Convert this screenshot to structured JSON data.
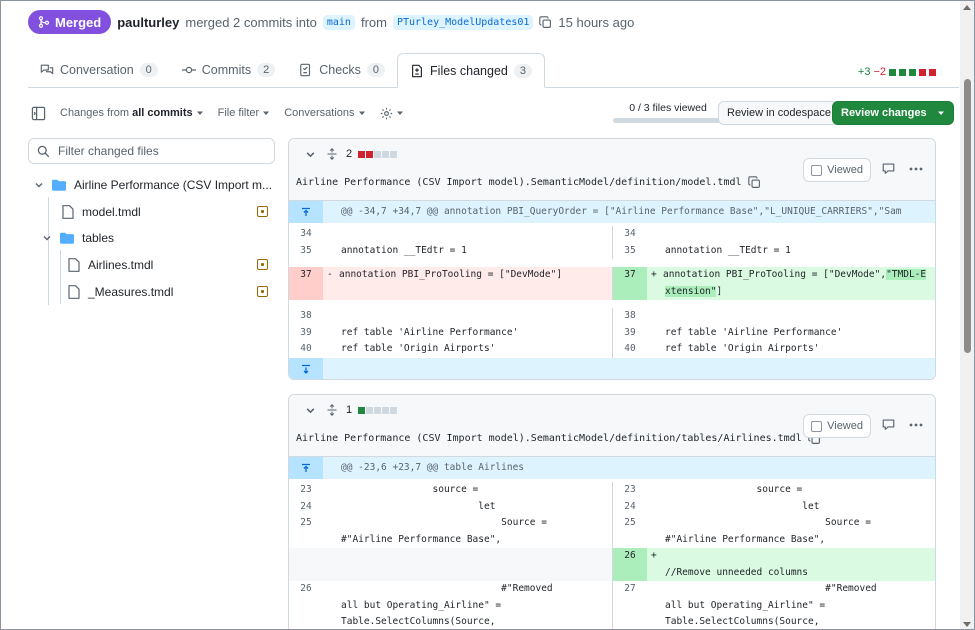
{
  "header": {
    "status": "Merged",
    "user": "paulturley",
    "action": "merged 2 commits into",
    "base_branch": "main",
    "from": "from",
    "head_branch": "PTurley_ModelUpdates01",
    "time": "15 hours ago"
  },
  "tabs": [
    {
      "label": "Conversation",
      "count": "0"
    },
    {
      "label": "Commits",
      "count": "2"
    },
    {
      "label": "Checks",
      "count": "0"
    },
    {
      "label": "Files changed",
      "count": "3"
    }
  ],
  "diffstat": {
    "additions": "+3",
    "deletions": "−2"
  },
  "toolbar": {
    "changes_from_prefix": "Changes from",
    "changes_from_value": "all commits",
    "file_filter": "File filter",
    "conversations": "Conversations",
    "files_viewed": "0 / 3 files viewed",
    "review_codespace": "Review in codespace",
    "review_changes": "Review changes"
  },
  "sidebar": {
    "search_placeholder": "Filter changed files",
    "tree": {
      "root_folder": "Airline Performance (CSV Import m...",
      "file_model": "model.tmdl",
      "folder_tables": "tables",
      "file_airlines": "Airlines.tmdl",
      "file_measures": "_Measures.tmdl"
    }
  },
  "diff1": {
    "changes": "2",
    "path": "Airline Performance (CSV Import model).SemanticModel/definition/model.tmdl",
    "viewed_label": "Viewed",
    "hunk": "@@ -34,7 +34,7 @@ annotation PBI_QueryOrder = [\"Airline Performance Base\",\"L_UNIQUE_CARRIERS\",\"Sam",
    "rows": [
      {
        "l_num": "34",
        "l_code": "",
        "r_num": "34",
        "r_code": ""
      },
      {
        "l_num": "35",
        "l_code": "annotation __TEdtr = 1",
        "r_num": "35",
        "r_code": "annotation __TEdtr = 1"
      },
      {
        "l_num": "37",
        "l_code": "annotation PBI_ProTooling = [\"DevMode\"]",
        "r_num": "37",
        "r_code_a": "annotation PBI_ProTooling = [\"DevMode\",",
        "r_code_b": "\"TMDL-Extension\"",
        "r_code_c": "]"
      },
      {
        "l_num": "38",
        "l_code": "",
        "r_num": "38",
        "r_code": ""
      },
      {
        "l_num": "39",
        "l_code": "ref table 'Airline Performance'",
        "r_num": "39",
        "r_code": "ref table 'Airline Performance'"
      },
      {
        "l_num": "40",
        "l_code": "ref table 'Origin Airports'",
        "r_num": "40",
        "r_code": "ref table 'Origin Airports'"
      }
    ]
  },
  "diff2": {
    "changes": "1",
    "path": "Airline Performance (CSV Import model).SemanticModel/definition/tables/Airlines.tmdl",
    "viewed_label": "Viewed",
    "hunk": "@@ -23,6 +23,7 @@ table Airlines",
    "rows": [
      {
        "l_num": "23",
        "l_code": "                source =",
        "r_num": "23",
        "r_code": "                source ="
      },
      {
        "l_num": "24",
        "l_code": "                        let",
        "r_num": "24",
        "r_code": "                        let"
      },
      {
        "l_num": "25",
        "l_code": "                            Source =\n#\"Airline Performance Base\",",
        "r_num": "25",
        "r_code": "                            Source =\n#\"Airline Performance Base\","
      },
      {
        "l_num": "",
        "l_code": "",
        "r_num": "26",
        "r_code": "\n//Remove unneeded columns"
      },
      {
        "l_num": "26",
        "l_code": "                            #\"Removed\nall but Operating_Airline\" =\nTable.SelectColumns(Source,",
        "r_num": "27",
        "r_code": "                            #\"Removed\nall but Operating_Airline\" =\nTable.SelectColumns(Source,"
      }
    ]
  }
}
